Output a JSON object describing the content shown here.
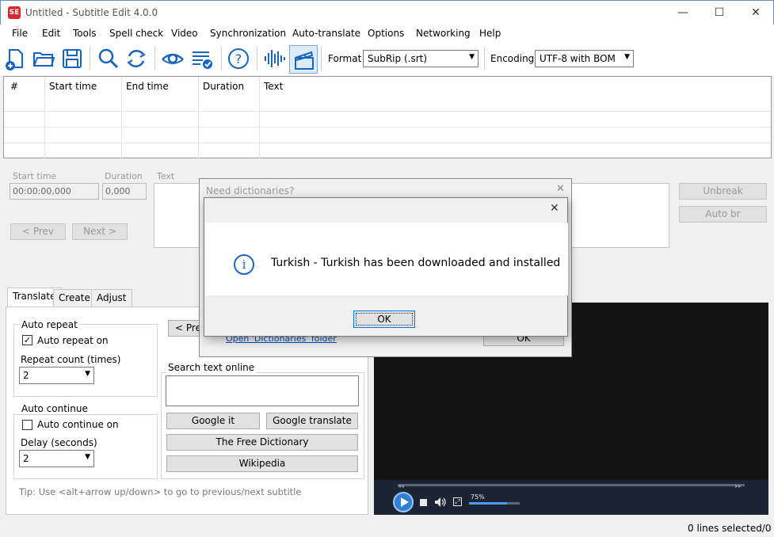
{
  "window": {
    "title": "Untitled - Subtitle Edit 4.0.0",
    "logo_text": "SE",
    "minimize": "—",
    "maximize": "☐",
    "close": "✕"
  },
  "menu": [
    "File",
    "Edit",
    "Tools",
    "Spell check",
    "Video",
    "Synchronization",
    "Auto-translate",
    "Options",
    "Networking",
    "Help"
  ],
  "toolbar": {
    "icons": [
      "new-file-icon",
      "open-folder-icon",
      "save-icon",
      "find-icon",
      "replace-icon",
      "visual-sync-icon",
      "spell-check-icon",
      "help-icon",
      "waveform-icon",
      "video-icon"
    ],
    "format_label": "Format",
    "format_value": "SubRip (.srt)",
    "encoding_label": "Encoding",
    "encoding_value": "UTF-8 with BOM"
  },
  "grid": {
    "columns": [
      "#",
      "Start time",
      "End time",
      "Duration",
      "Text"
    ]
  },
  "edit": {
    "start_time_label": "Start time",
    "start_time_value": "00:00:00,000",
    "duration_label": "Duration",
    "duration_value": "0,000",
    "text_label": "Text",
    "prev_button": "< Prev",
    "next_button": "Next >",
    "unbreak_button": "Unbreak",
    "auto_br_button": "Auto br"
  },
  "tabs": [
    "Translate",
    "Create",
    "Adjust"
  ],
  "translate": {
    "auto_repeat_title": "Auto repeat",
    "auto_repeat_on_label": "Auto repeat on",
    "auto_repeat_checked": "✓",
    "repeat_count_label": "Repeat count (times)",
    "repeat_count_value": "2",
    "auto_continue_title": "Auto continue",
    "auto_continue_on_label": "Auto continue on",
    "delay_label": "Delay (seconds)",
    "delay_value": "2",
    "prev_partial": "< Prev",
    "search_online_title": "Search text online",
    "google_it": "Google it",
    "google_translate": "Google translate",
    "free_dictionary": "The Free Dictionary",
    "wikipedia": "Wikipedia",
    "tip": "Tip: Use <alt+arrow up/down> to go to previous/next subtitle"
  },
  "video": {
    "volume_percent": "75%",
    "volume_level": 0.75
  },
  "status": {
    "lines_selected": "0 lines selected/0"
  },
  "bg_dialog": {
    "title": "Need dictionaries?",
    "link": "Open 'Dictionaries' folder",
    "ok": "OK",
    "close": "✕"
  },
  "message_box": {
    "message": "Turkish - Turkish has been downloaded and installed",
    "ok": "OK",
    "close": "✕",
    "info_glyph": "i"
  }
}
